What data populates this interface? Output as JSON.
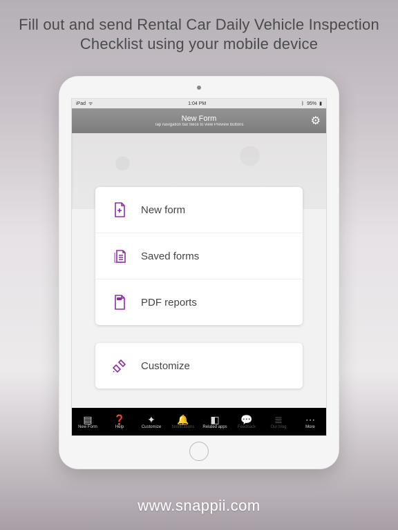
{
  "promo": {
    "headline": "Fill out and send Rental Car Daily Vehicle Inspection Checklist using your mobile device"
  },
  "statusbar": {
    "carrier": "iPad",
    "time": "1:04 PM",
    "battery": "95%"
  },
  "navbar": {
    "title": "New Form",
    "subtitle": "Tap navigation bar twice to view Preview buttons"
  },
  "menu": {
    "items": [
      {
        "label": "New form",
        "icon": "new-form-icon"
      },
      {
        "label": "Saved forms",
        "icon": "saved-forms-icon"
      },
      {
        "label": "PDF reports",
        "icon": "pdf-reports-icon"
      }
    ],
    "secondary": [
      {
        "label": "Customize",
        "icon": "customize-icon"
      }
    ]
  },
  "tabbar": {
    "items": [
      {
        "label": "New Form",
        "active": true
      },
      {
        "label": "Help",
        "active": true
      },
      {
        "label": "Customize",
        "active": true
      },
      {
        "label": "Notifications",
        "active": false
      },
      {
        "label": "Related apps",
        "active": true
      },
      {
        "label": "Feedback",
        "active": false
      },
      {
        "label": "Our blog",
        "active": false
      },
      {
        "label": "More",
        "active": true
      }
    ]
  },
  "footer": {
    "url": "www.snappii.com"
  }
}
